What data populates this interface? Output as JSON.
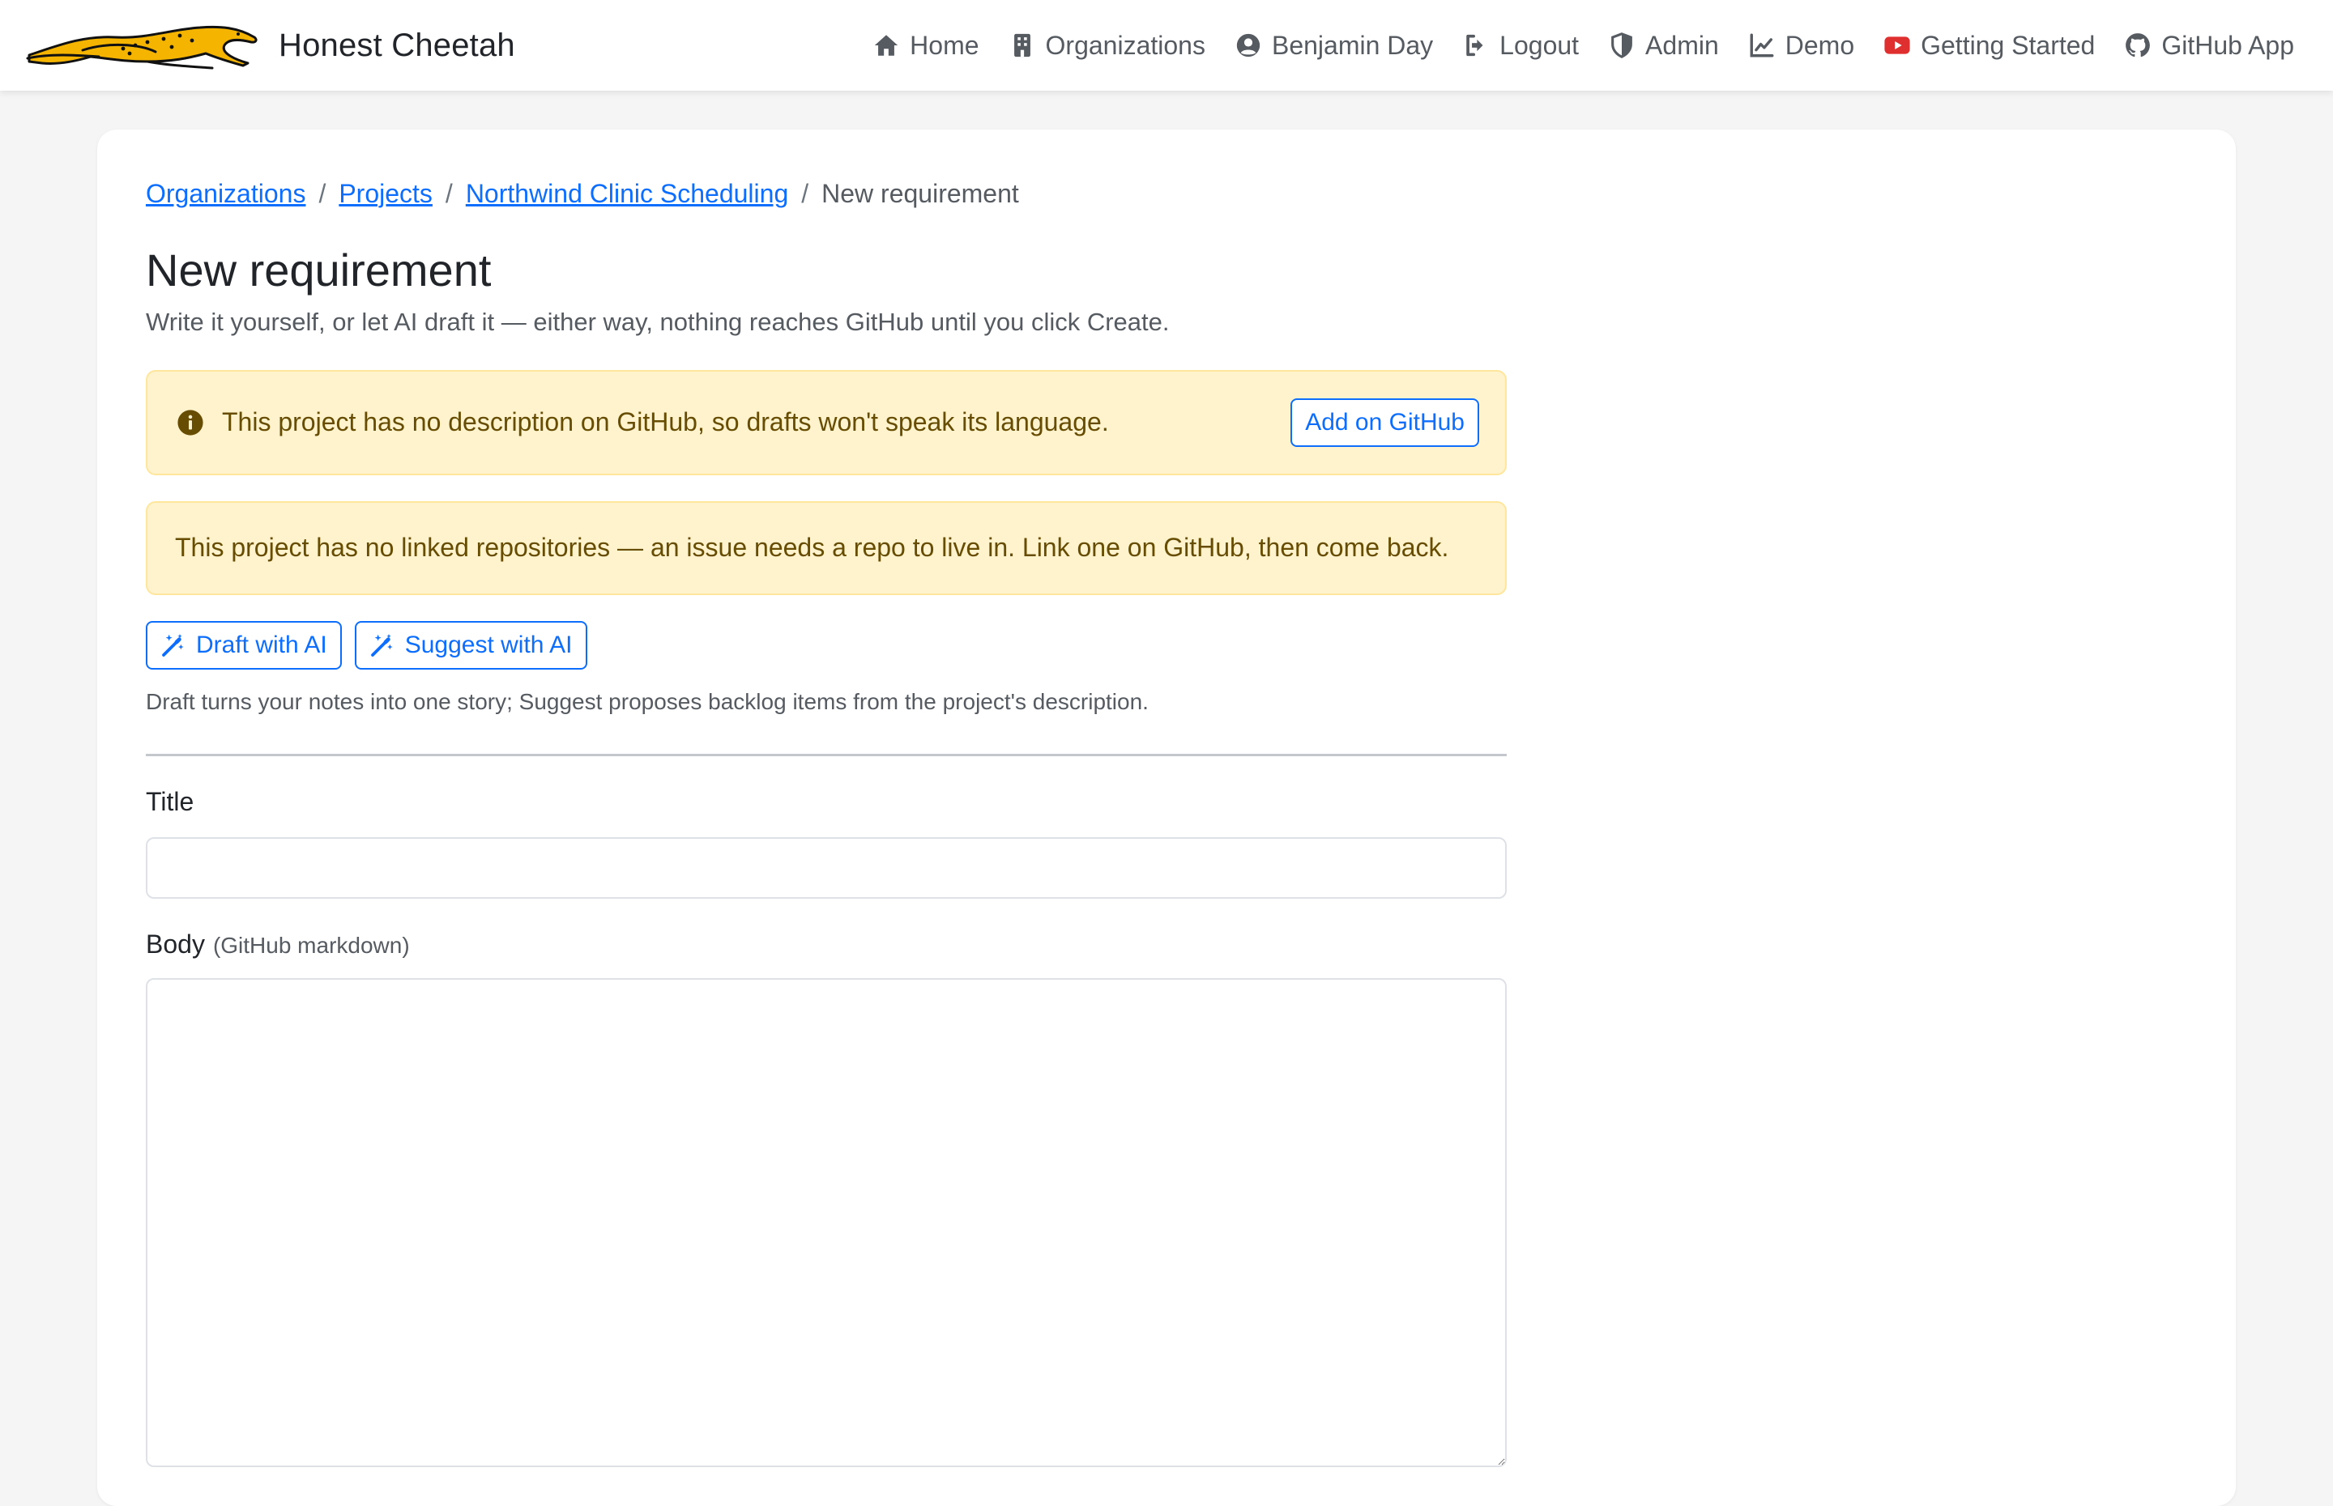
{
  "app": {
    "brand_name": "Honest Cheetah"
  },
  "nav": {
    "items": [
      {
        "label": "Home",
        "icon": "home-icon"
      },
      {
        "label": "Organizations",
        "icon": "building-icon"
      },
      {
        "label": "Benjamin Day",
        "icon": "user-circle-icon"
      },
      {
        "label": "Logout",
        "icon": "logout-icon"
      },
      {
        "label": "Admin",
        "icon": "shield-icon"
      },
      {
        "label": "Demo",
        "icon": "chart-line-icon"
      },
      {
        "label": "Getting Started",
        "icon": "youtube-icon"
      },
      {
        "label": "GitHub App",
        "icon": "github-icon"
      }
    ]
  },
  "breadcrumb": {
    "items": [
      {
        "label": "Organizations"
      },
      {
        "label": "Projects"
      },
      {
        "label": "Northwind Clinic Scheduling"
      }
    ],
    "current": "New requirement",
    "separator": "/"
  },
  "page": {
    "title": "New requirement",
    "lead": "Write it yourself, or let AI draft it — either way, nothing reaches GitHub until you click Create."
  },
  "alerts": {
    "no_description": {
      "text": "This project has no description on GitHub, so drafts won't speak its language.",
      "button": "Add on GitHub",
      "icon": "info-circle-icon"
    },
    "no_repos": {
      "text": "This project has no linked repositories — an issue needs a repo to live in. Link one on GitHub, then come back."
    }
  },
  "ai": {
    "draft_label": "Draft with AI",
    "suggest_label": "Suggest with AI",
    "icon": "magic-wand-icon",
    "helper": "Draft turns your notes into one story; Suggest proposes backlog items from the project's description."
  },
  "form": {
    "title_label": "Title",
    "title_value": "",
    "body_label": "Body",
    "body_hint": "(GitHub markdown)",
    "body_value": ""
  },
  "colors": {
    "link": "#0d6efd",
    "warning_bg": "#fff3cd",
    "warning_border": "#ffe69c",
    "warning_text": "#664d03",
    "youtube_red": "#e02f2f",
    "logo_yellow": "#f4b400"
  }
}
